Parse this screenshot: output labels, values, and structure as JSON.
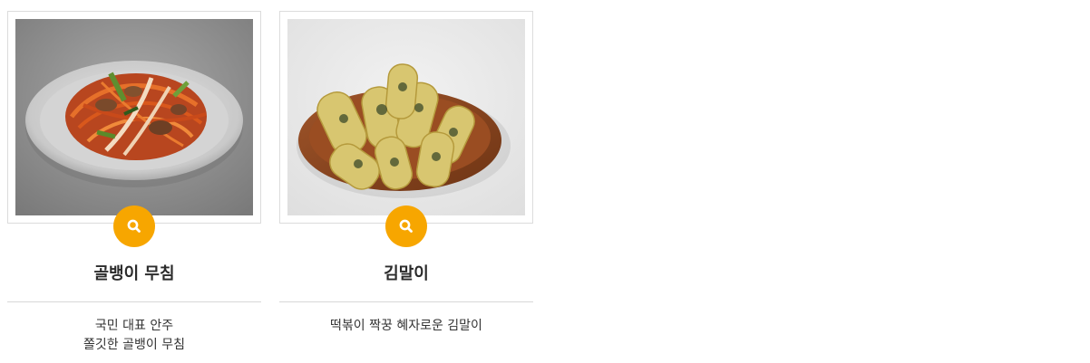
{
  "theme": {
    "accent": "#f7a600",
    "title_color": "#2b2b2b",
    "text_color": "#333333",
    "border_color": "#dcdcdc"
  },
  "products": [
    {
      "name": "골뱅이 무침",
      "description_lines": [
        "국민 대표 안주",
        "쫄깃한 골뱅이 무침"
      ],
      "zoom_icon": "magnifier-icon",
      "image_subject": "spicy-whelk-salad-on-steel-plate"
    },
    {
      "name": "김말이",
      "description_lines": [
        "떡볶이 짝꿍 혜자로운 김말이"
      ],
      "zoom_icon": "magnifier-icon",
      "image_subject": "seaweed-rolls-on-wooden-plate"
    }
  ]
}
